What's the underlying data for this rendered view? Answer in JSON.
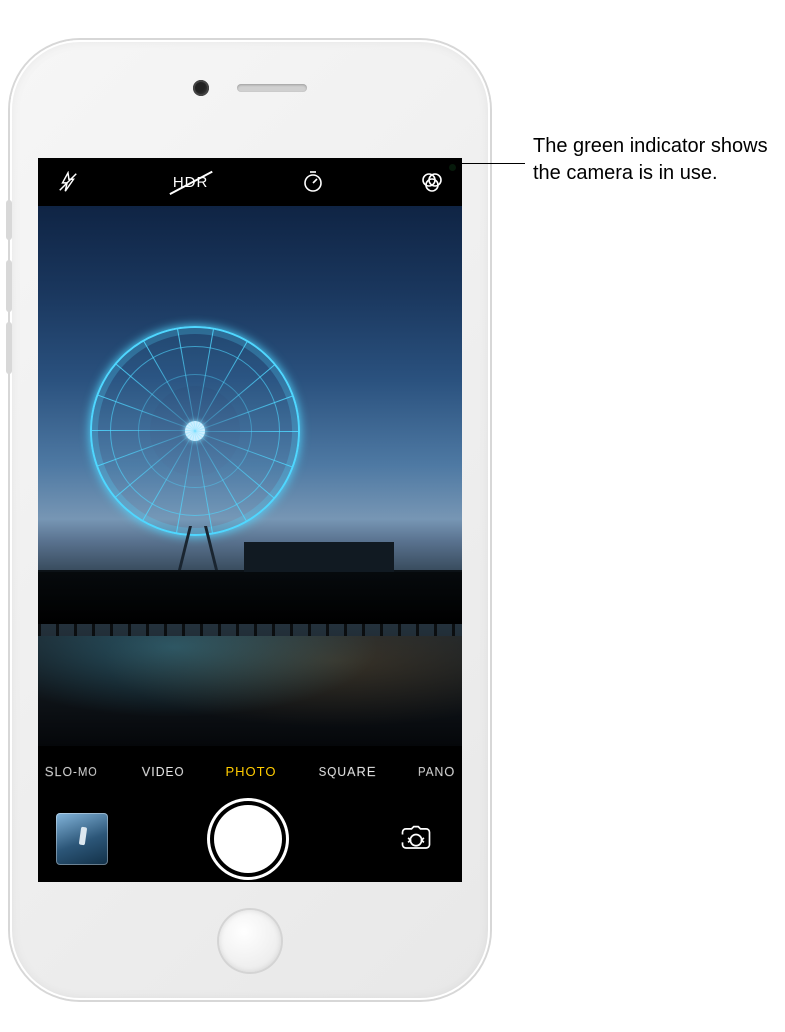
{
  "callout": "The green indicator shows the camera is in use.",
  "topbar": {
    "flash_icon": "flash-off-icon",
    "hdr_label": "HDR",
    "timer_icon": "timer-icon",
    "filters_icon": "filters-icon",
    "indicator": "camera-in-use-indicator"
  },
  "modes": [
    {
      "label": "SLO-MO",
      "active": false
    },
    {
      "label": "VIDEO",
      "active": false
    },
    {
      "label": "PHOTO",
      "active": true
    },
    {
      "label": "SQUARE",
      "active": false
    },
    {
      "label": "PANO",
      "active": false
    }
  ],
  "bottombar": {
    "thumbnail": "last-photo-thumbnail",
    "shutter": "shutter-button",
    "flip": "flip-camera-button"
  }
}
